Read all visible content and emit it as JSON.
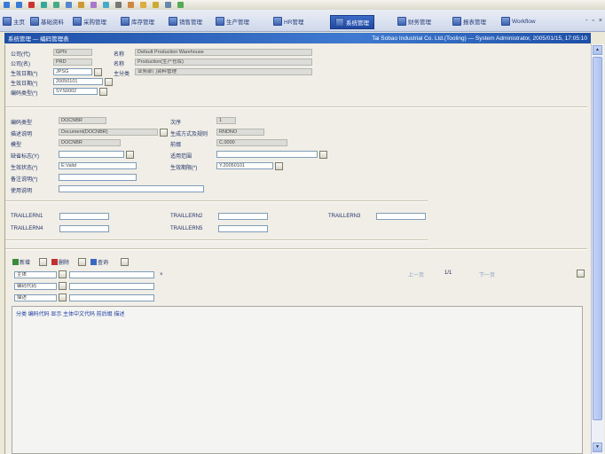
{
  "colors": {
    "accent": "#1f48a0",
    "title_band": "#2a5cb8",
    "readonly_field": "#dcdcd8"
  },
  "toolbar_icons": [
    "back-icon",
    "forward-icon",
    "stop-icon",
    "refresh-icon",
    "home-icon",
    "search-icon",
    "favorites-icon",
    "history-icon",
    "mail-icon",
    "print-icon",
    "edit-icon",
    "folder-icon",
    "lock-icon",
    "monitor-icon",
    "grid-icon"
  ],
  "tabs": [
    {
      "label": "主页"
    },
    {
      "label": "基础资料"
    },
    {
      "label": "采购管理"
    },
    {
      "label": "库存管理"
    },
    {
      "label": "销售管理"
    },
    {
      "label": "生产管理"
    },
    {
      "label": "HR管理"
    },
    {
      "label": "系统管理"
    },
    {
      "label": "财务管理"
    },
    {
      "label": "报表管理"
    },
    {
      "label": "Workflow"
    }
  ],
  "window_controls": {
    "minimize": "-",
    "restore": "▫",
    "close": "×"
  },
  "titlebar": {
    "left": "系统管理 — 编码管理表",
    "right": "Tai Sobao Industrial Co. Ltd.(Tooling) — System Administrator, 2005/01/15, 17:05:10"
  },
  "header_fields": {
    "row1": {
      "label": "公司(代)",
      "value": "GPN",
      "name_label": "名称",
      "name_value": "Default Production Warehouse"
    },
    "row2": {
      "label": "公司(名)",
      "value": "PRD",
      "name_label": "名称",
      "name_value": "Production(生产仓库)"
    },
    "row3": {
      "label": "生效日期(*)",
      "value": "JPSG",
      "dept_label": "主分类",
      "dept_value": "业务部门资料管理"
    },
    "row4": {
      "label": "生效日期(*)",
      "value": "20050101"
    },
    "row5": {
      "label": "编码类型(*)",
      "value": "SYS0002"
    }
  },
  "detail_fields": {
    "type": {
      "label": "编码类型",
      "value": "DOCNBR"
    },
    "desc": {
      "label": "描述说明",
      "value": "Document(DOCNBR)"
    },
    "model": {
      "label": "模型",
      "value": "DOCNBR"
    },
    "default_flag": {
      "label": "缺省标志(Y)",
      "value": ""
    },
    "sys_status": {
      "label": "生效状态(*)",
      "value": "E:Valid"
    },
    "remark": {
      "label": "备注说明(*)",
      "value": ""
    },
    "extra": {
      "label": "使用说明",
      "value": ""
    },
    "seq": {
      "label": "次序",
      "value": "1"
    },
    "gen_type": {
      "label": "生成方式及规则",
      "value": "RNDNO"
    },
    "prefix": {
      "label": "前缀",
      "value": "C.0000"
    },
    "category": {
      "label": "适用范围",
      "value": ""
    },
    "effective": {
      "label": "生效期限(*)",
      "value": "Y.20050101"
    }
  },
  "trail_labels": [
    "TRAILLERN1",
    "TRAILLERN2",
    "TRAILLERN3",
    "TRAILLERN4",
    "TRAILLERN5"
  ],
  "grid_toolbar": {
    "add": "新增",
    "delete": "删除",
    "query": "查询",
    "pager_prev": "上一页",
    "pager_page": "1/1",
    "pager_next": "下一页"
  },
  "filters": [
    {
      "label": "主体",
      "value": ""
    },
    {
      "label": "编码代码",
      "value": ""
    },
    {
      "label": "描述",
      "value": ""
    }
  ],
  "grid_header": "分类 编码代码 显示 主体中文代码 前后缀 描述"
}
